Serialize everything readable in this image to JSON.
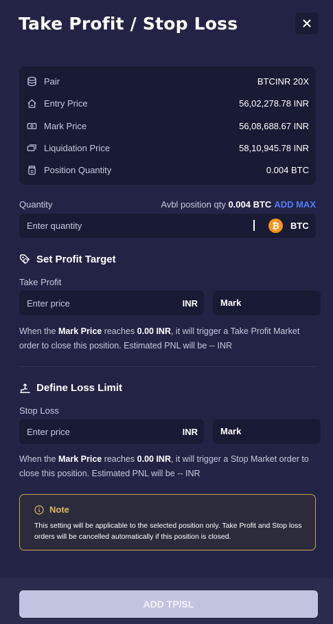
{
  "header": {
    "title": "Take Profit / Stop Loss",
    "close_icon": "close-icon"
  },
  "info": {
    "rows": [
      {
        "icon": "coins-stack-icon",
        "label": "Pair",
        "value": "BTCINR 20X"
      },
      {
        "icon": "home-price-icon",
        "label": "Entry Price",
        "value": "56,02,278.78 INR"
      },
      {
        "icon": "banknote-icon",
        "label": "Mark Price",
        "value": "56,08,688.67 INR"
      },
      {
        "icon": "cash-stack-icon",
        "label": "Liquidation Price",
        "value": "58,10,945.78 INR"
      },
      {
        "icon": "coin-jar-icon",
        "label": "Position Quantity",
        "value": "0.004 BTC"
      }
    ]
  },
  "quantity": {
    "label": "Quantity",
    "avbl_label": "Avbl position qty",
    "avbl_value": "0.004 BTC",
    "add_max": "ADD MAX",
    "placeholder": "Enter quantity",
    "currency_symbol": "₿",
    "currency": "BTC"
  },
  "profit": {
    "title": "Set Profit Target",
    "field_label": "Take Profit",
    "placeholder": "Enter price",
    "unit": "INR",
    "trigger": "Mark",
    "desc": {
      "p1": "When the ",
      "b1": "Mark Price",
      "p2": " reaches ",
      "b2": "0.00 INR",
      "p3": ", it will trigger a Take Profit Market order to close this position. Estimated PNL will be -- INR"
    }
  },
  "loss": {
    "title": "Define Loss Limit",
    "field_label": "Stop Loss",
    "placeholder": "Enter price",
    "unit": "INR",
    "trigger": "Mark",
    "desc": {
      "p1": "When the ",
      "b1": "Mark Price",
      "p2": " reaches ",
      "b2": "0.00 INR",
      "p3": ", it will trigger a Stop Market order to close this position. Estimated PNL will be -- INR"
    }
  },
  "note": {
    "title": "Note",
    "text": "This setting will be applicable to the selected position only. Take Profit and Stop loss orders will be cancelled automatically if this position is closed."
  },
  "footer": {
    "button": "ADD TP/SL"
  },
  "colors": {
    "background": "#232445",
    "card": "#191a34",
    "accent": "#4f7cf5",
    "note_border": "#c9a24a",
    "btc": "#f7931a"
  }
}
